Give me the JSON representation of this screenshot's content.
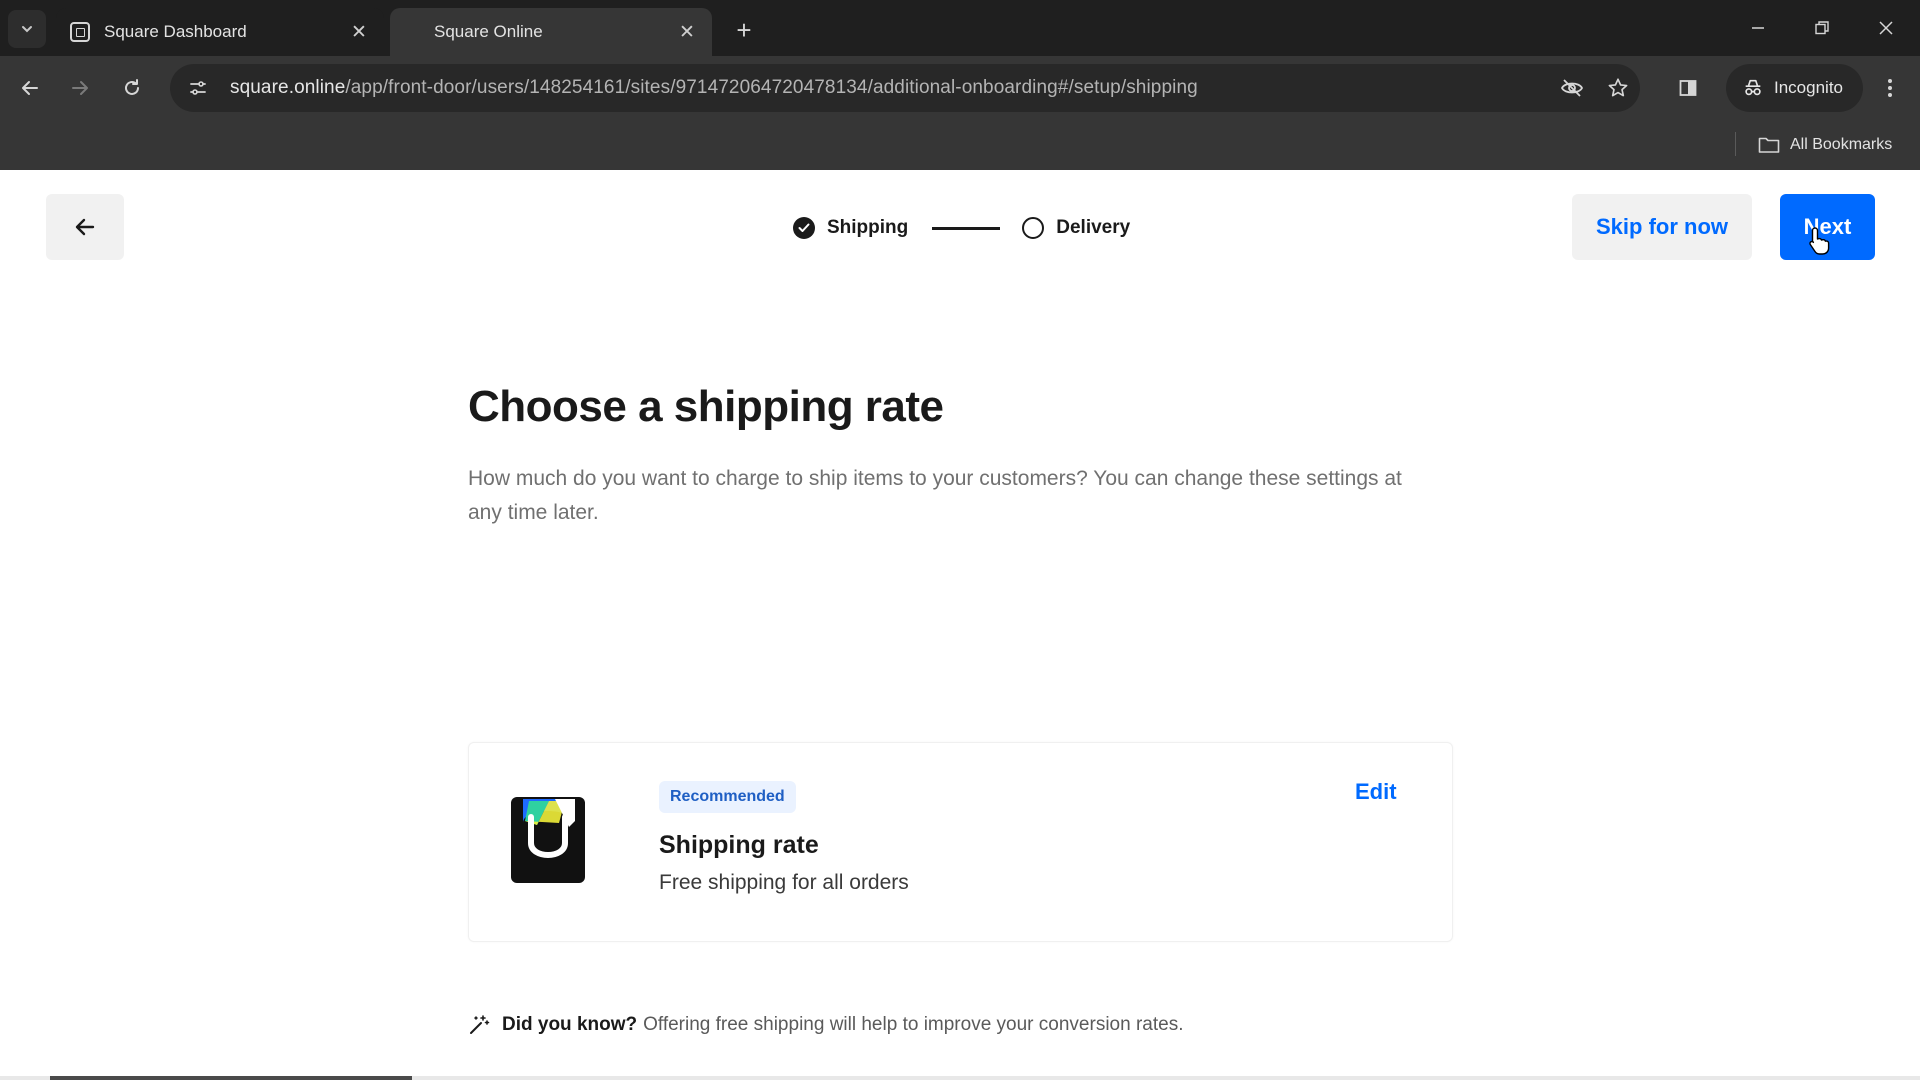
{
  "browser": {
    "tabs": [
      {
        "title": "Square Dashboard",
        "active": false
      },
      {
        "title": "Square Online",
        "active": true
      }
    ],
    "url_host": "square.online",
    "url_path": "/app/front-door/users/148254161/sites/971472064720478134/additional-onboarding#/setup/shipping",
    "incognito_label": "Incognito",
    "bookmarks_label": "All Bookmarks"
  },
  "stepper": {
    "steps": [
      {
        "label": "Shipping",
        "state": "complete"
      },
      {
        "label": "Delivery",
        "state": "pending"
      }
    ]
  },
  "actions": {
    "skip_label": "Skip for now",
    "next_label": "Next"
  },
  "main": {
    "heading": "Choose a shipping rate",
    "subtitle": "How much do you want to charge to ship items to your customers? You can change these settings at any time later.",
    "card": {
      "badge": "Recommended",
      "title": "Shipping rate",
      "description": "Free shipping for all orders",
      "edit_label": "Edit"
    },
    "tip": {
      "bold": "Did you know?",
      "text": "Offering free shipping will help to improve your conversion rates."
    }
  },
  "colors": {
    "accent": "#006aff",
    "badge_bg": "#eaf2ff",
    "text_primary": "#1a1a1a"
  }
}
